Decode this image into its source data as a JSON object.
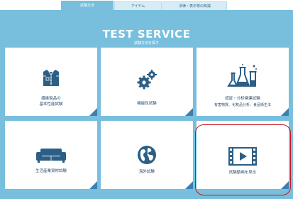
{
  "tabs": [
    {
      "label": "試験方法",
      "active": true
    },
    {
      "label": "アイテム",
      "active": false
    },
    {
      "label": "法律・表示等の知識",
      "active": false
    }
  ],
  "hero": {
    "title": "TEST SERVICE",
    "subtitle": "試験方法を探す"
  },
  "cards": [
    {
      "label_line1": "繊維製品の",
      "label_line2": "基本性能試験",
      "icon": "shirt-icon"
    },
    {
      "label": "機能性試験",
      "icon": "gears-icon"
    },
    {
      "label": "認証・分析関連試験",
      "sub": "有害物質、化粧品分析、食品衛生法",
      "icon": "lab-flasks-icon"
    },
    {
      "label": "生活産業資材試験",
      "icon": "sofa-icon"
    },
    {
      "label": "海外試験",
      "icon": "globe-icon"
    },
    {
      "label": "試験動画を見る",
      "icon": "video-play-icon"
    }
  ],
  "colors": {
    "panel": "#78bfdd",
    "icon": "#2c5f86",
    "corner": "#3d7fb0",
    "highlight": "#c8141e"
  }
}
